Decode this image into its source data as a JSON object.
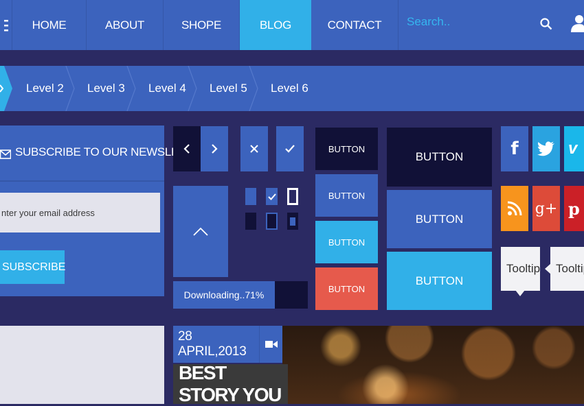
{
  "nav": {
    "items": [
      {
        "label": "HOME"
      },
      {
        "label": "ABOUT"
      },
      {
        "label": "SHOPE"
      },
      {
        "label": "BLOG"
      },
      {
        "label": "CONTACT"
      }
    ],
    "active": "BLOG",
    "search_placeholder": "Search.."
  },
  "breadcrumb": {
    "items": [
      "Level 2",
      "Level 3",
      "Level 4",
      "Level 5",
      "Level 6"
    ]
  },
  "newsletter": {
    "title": "SUBSCRIBE TO OUR NEWSLETTER",
    "email_placeholder": "nter your email address",
    "subscribe_label": "SUBSCRIBE"
  },
  "progress": {
    "label": "Downloading..71%",
    "value": 71
  },
  "buttons": {
    "small": [
      "BUTTON",
      "BUTTON",
      "BUTTON",
      "BUTTON"
    ],
    "large": [
      "BUTTON",
      "BUTTON",
      "BUTTON"
    ]
  },
  "tooltips": [
    "Tooltip",
    "Tooltip"
  ],
  "post": {
    "date": "28 APRIL,2013",
    "headline": "BEST STORY YOU"
  },
  "social": [
    "facebook-icon",
    "twitter-icon",
    "vimeo-icon",
    "rss-icon",
    "google-plus-icon",
    "pinterest-icon"
  ],
  "colors": {
    "primary_blue": "#3c63bd",
    "accent_cyan": "#31b0e8",
    "dark_navy": "#111137",
    "background": "#2b2a63",
    "red": "#e65a4c",
    "orange_rss": "#f7941d",
    "google_red": "#dd4b39",
    "pinterest_red": "#cb2027",
    "twitter_blue": "#2aa3e0",
    "vimeo_cyan": "#1ab7ea"
  }
}
